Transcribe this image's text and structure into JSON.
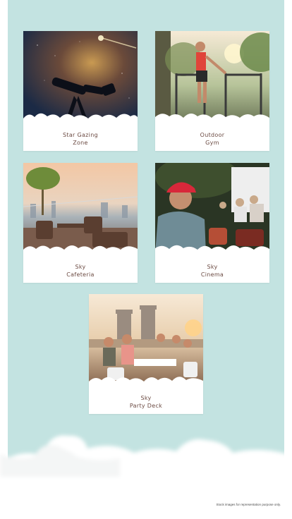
{
  "amenities": [
    {
      "line1": "Star Gazing",
      "line2": "Zone"
    },
    {
      "line1": "Outdoor",
      "line2": "Gym"
    },
    {
      "line1": "Sky",
      "line2": "Cafeteria"
    },
    {
      "line1": "Sky",
      "line2": "Cinema"
    },
    {
      "line1": "Sky",
      "line2": "Party Deck"
    }
  ],
  "disclaimer": "Stock images for representation purpose only.",
  "colors": {
    "background": "#c3e3e1",
    "caption": "#6b4a42",
    "card": "#ffffff"
  }
}
